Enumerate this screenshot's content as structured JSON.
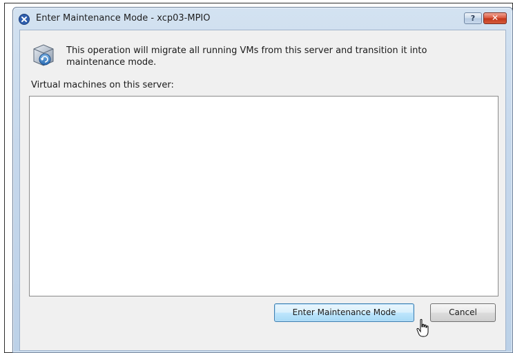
{
  "window": {
    "title": "Enter Maintenance Mode - xcp03-MPIO",
    "help_label": "?",
    "close_label": "✕"
  },
  "dialog": {
    "message": "This operation will migrate all running VMs from this server and transition it into maintenance mode.",
    "vm_list_label": "Virtual machines on this server:",
    "vm_list_items": []
  },
  "buttons": {
    "enter_maintenance_label": "Enter Maintenance Mode",
    "cancel_label": "Cancel"
  },
  "icons": {
    "app": "xenserver-app-icon",
    "operation": "server-maintenance-icon",
    "cursor": "hand-pointer-icon"
  },
  "colors": {
    "accent": "#3c7fb1",
    "close": "#c2361a"
  }
}
